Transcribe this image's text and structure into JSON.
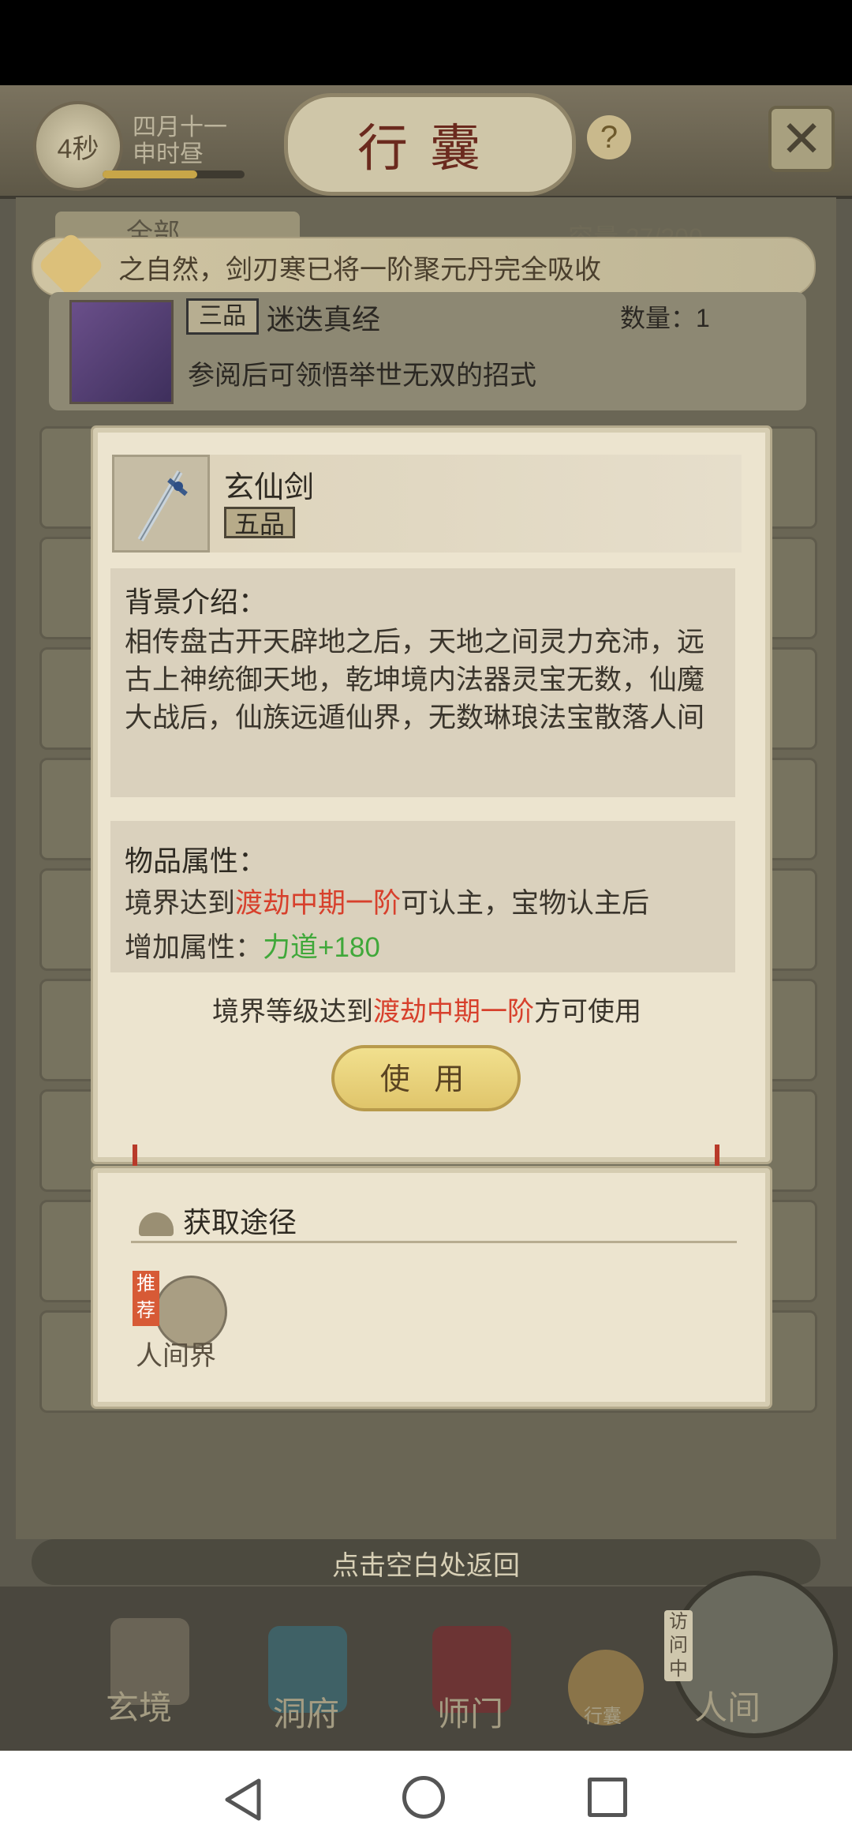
{
  "header": {
    "timer": "4秒",
    "date_line1": "四月十一",
    "date_line2": "申时昼",
    "title": "行囊",
    "help": "?",
    "close": "✕"
  },
  "list": {
    "filter_label": "全部",
    "capacity": "容量 27/200"
  },
  "notice": {
    "text": "之自然，剑刃寒已将一阶聚元丹完全吸收"
  },
  "book_item": {
    "grade": "三品",
    "name": "迷迭真经",
    "quantity": "数量：1",
    "description": "参阅后可领悟举世无双的招式"
  },
  "dialog": {
    "item_name": "玄仙剑",
    "item_grade": "五品",
    "background_title": "背景介绍：",
    "background_text": "相传盘古开天辟地之后，天地之间灵力充沛，远古上神统御天地，乾坤境内法器灵宝无数，仙魔大战后，仙族远遁仙界，无数琳琅法宝散落人间",
    "attributes_title": "物品属性：",
    "attr_line1_pre": "境界达到",
    "attr_line1_highlight": "渡劫中期一阶",
    "attr_line1_post": "可认主，宝物认主后",
    "attr_line2_pre": "增加属性：",
    "attr_line2_value": "力道+180",
    "requirement_pre": "境界等级达到",
    "requirement_highlight": "渡劫中期一阶",
    "requirement_post": "方可使用",
    "use_button": "使 用"
  },
  "source": {
    "title": "获取途径",
    "badge_tag": "推荐",
    "badge_label": "人间界"
  },
  "return_hint": "点击空白处返回",
  "nav": {
    "items": [
      {
        "label": "玄境"
      },
      {
        "label": "洞府"
      },
      {
        "label": "师门"
      },
      {
        "label": "行囊"
      },
      {
        "label": "人间"
      }
    ],
    "visiting": "访问中"
  },
  "colors": {
    "highlight_red": "#d7402c",
    "highlight_green": "#40a83a"
  }
}
